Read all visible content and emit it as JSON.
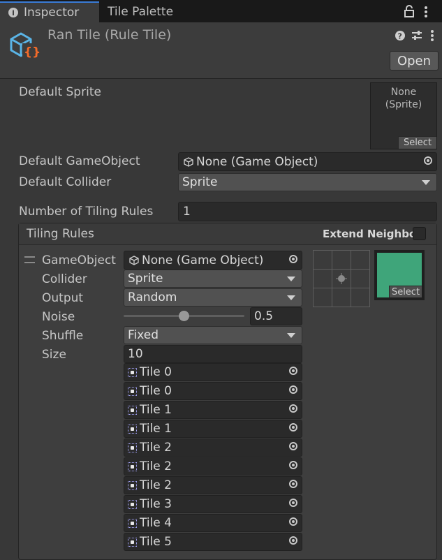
{
  "tabs": {
    "inspector": "Inspector",
    "tile_palette": "Tile Palette"
  },
  "header": {
    "title": "Ran Tile (Rule Tile)",
    "open_button": "Open"
  },
  "default_sprite": {
    "label": "Default Sprite",
    "none_line1": "None",
    "none_line2": "(Sprite)",
    "select": "Select"
  },
  "default_gameobject": {
    "label": "Default GameObject",
    "value": "None (Game Object)"
  },
  "default_collider": {
    "label": "Default Collider",
    "value": "Sprite"
  },
  "num_rules": {
    "label": "Number of Tiling Rules",
    "value": "1"
  },
  "tiling_rules": {
    "title": "Tiling Rules",
    "extend_neighbor": "Extend Neighbor",
    "gameobject": {
      "label": "GameObject",
      "value": "None (Game Object)"
    },
    "collider": {
      "label": "Collider",
      "value": "Sprite"
    },
    "output": {
      "label": "Output",
      "value": "Random"
    },
    "noise": {
      "label": "Noise",
      "value": "0.5"
    },
    "shuffle": {
      "label": "Shuffle",
      "value": "Fixed"
    },
    "size": {
      "label": "Size",
      "value": "10"
    },
    "sprite_select": "Select",
    "tiles": [
      "Tile 0",
      "Tile 0",
      "Tile 1",
      "Tile 1",
      "Tile 2",
      "Tile 2",
      "Tile 2",
      "Tile 3",
      "Tile 4",
      "Tile 5"
    ]
  },
  "colors": {
    "accent_tab": "#3a7cd8",
    "sprite_preview": "#3fa57a",
    "icon_orange": "#f36b2a",
    "icon_blue": "#5ab4e6"
  }
}
